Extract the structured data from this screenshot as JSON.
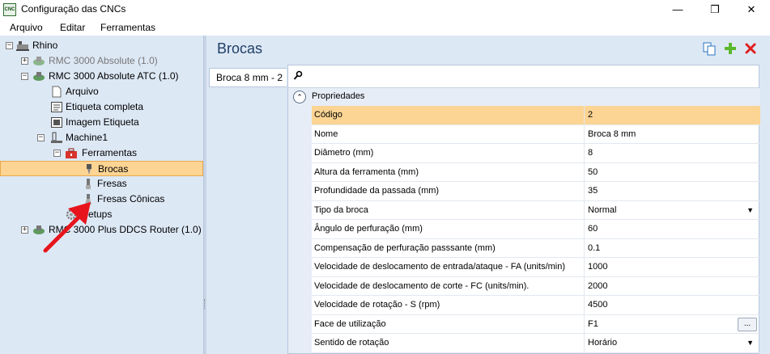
{
  "window": {
    "title": "Configuração das CNCs",
    "icon_text": "CNC",
    "controls": {
      "minimize": "—",
      "maximize": "❐",
      "close": "✕"
    }
  },
  "menu": [
    "Arquivo",
    "Editar",
    "Ferramentas"
  ],
  "tree": {
    "root": "Rhino",
    "items": [
      {
        "label": "RMC 3000 Absolute (1.0)",
        "expander": "+"
      },
      {
        "label": "RMC 3000 Absolute ATC (1.0)",
        "expander": "−"
      },
      {
        "label": "Arquivo"
      },
      {
        "label": "Etiqueta completa"
      },
      {
        "label": "Imagem Etiqueta"
      },
      {
        "label": "Machine1",
        "expander": "−"
      },
      {
        "label": "Ferramentas",
        "expander": "−"
      },
      {
        "label": "Brocas"
      },
      {
        "label": "Fresas"
      },
      {
        "label": "Fresas Cônicas"
      },
      {
        "label": "Setups"
      },
      {
        "label": "RMC 3000 Plus DDCS Router (1.0)",
        "expander": "+"
      }
    ],
    "root_expander": "−",
    "selected": "Brocas"
  },
  "main": {
    "title": "Brocas",
    "tab_label": "Broca 8 mm - 2",
    "category": "Propriedades",
    "properties": [
      {
        "name": "Código",
        "value": "2"
      },
      {
        "name": "Nome",
        "value": "Broca 8 mm"
      },
      {
        "name": "Diâmetro (mm)",
        "value": "8"
      },
      {
        "name": "Altura da ferramenta (mm)",
        "value": "50"
      },
      {
        "name": "Profundidade da passada (mm)",
        "value": "35"
      },
      {
        "name": "Tipo da broca",
        "value": "Normal"
      },
      {
        "name": "Ângulo de perfuração (mm)",
        "value": "60"
      },
      {
        "name": "Compensação de perfuração passsante (mm)",
        "value": "0.1"
      },
      {
        "name": "Velocidade de deslocamento de entrada/ataque - FA (units/min)",
        "value": "1000"
      },
      {
        "name": "Velocidade de deslocamento de corte - FC (units/min).",
        "value": "2000"
      },
      {
        "name": "Velocidade de rotação - S (rpm)",
        "value": "4500"
      },
      {
        "name": "Face de utilização",
        "value": "F1"
      },
      {
        "name": "Sentido de rotação",
        "value": "Horário"
      }
    ],
    "ellipsis": "...",
    "dropdown_arrow": "▼"
  },
  "colors": {
    "selection": "#fcd493",
    "pane_bg": "#dde8f5",
    "title": "#1f3f66",
    "arrow": "#e8141c"
  }
}
